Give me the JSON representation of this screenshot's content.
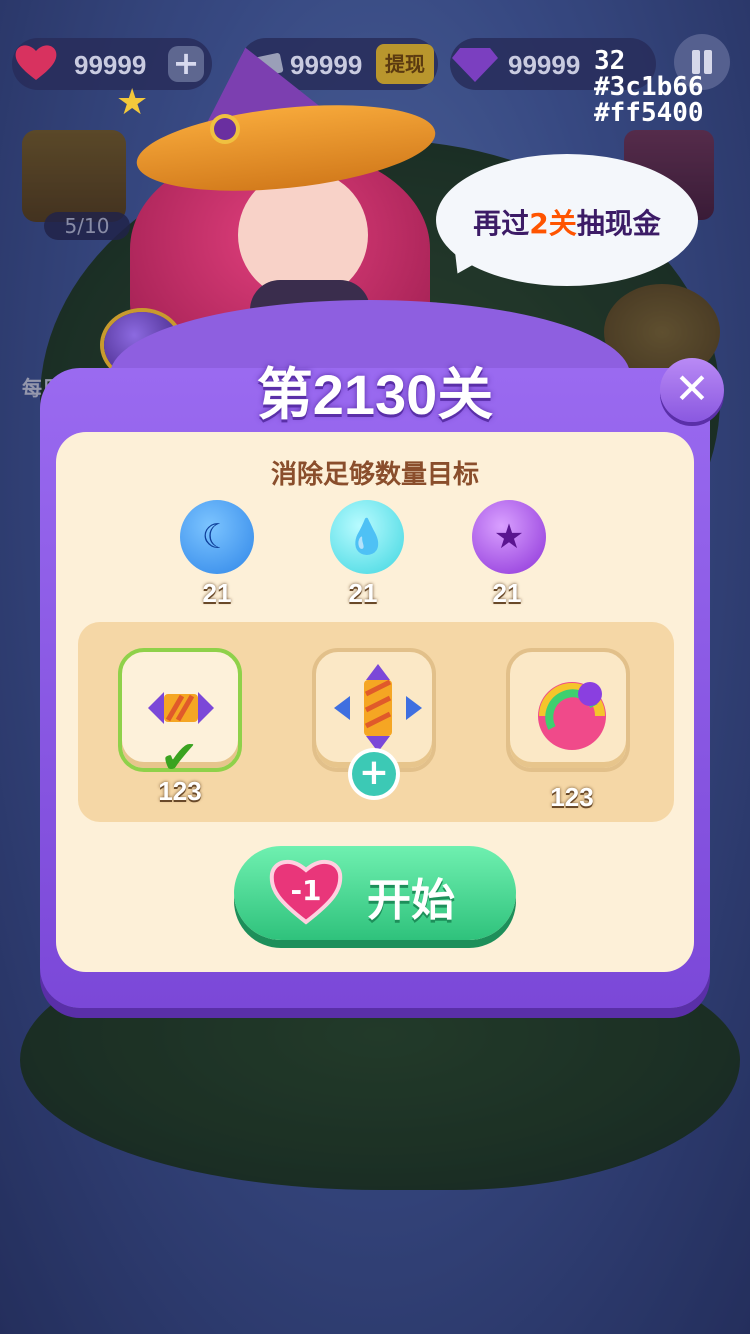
{
  "topbar": {
    "hearts": "99999",
    "coins": "99999",
    "cash_button": "提现",
    "gems": "99999"
  },
  "corner_debug": [
    "32",
    "#3c1b66",
    "#ff5400"
  ],
  "side": {
    "chest_progress": "5/10",
    "daily_label": "每日"
  },
  "bubble": {
    "prefix": "再过",
    "highlight": "2关",
    "suffix": "抽现金"
  },
  "modal": {
    "title": "第2130关",
    "goal_title": "消除足够数量目标",
    "targets": [
      {
        "icon": "blue-moon-candy-icon",
        "count": "21",
        "color": "#2f86e8"
      },
      {
        "icon": "cyan-drop-candy-icon",
        "count": "21",
        "color": "#3fd6e0"
      },
      {
        "icon": "purple-star-candy-icon",
        "count": "21",
        "color": "#8c32d8"
      }
    ],
    "boosters": [
      {
        "icon": "striped-candy-icon",
        "count": "123",
        "selected": true
      },
      {
        "icon": "cross-striped-candy-icon",
        "count": "",
        "selected": false
      },
      {
        "icon": "rainbow-ball-icon",
        "count": "123",
        "selected": false
      }
    ],
    "start": {
      "heart_cost": "-1",
      "label": "开始"
    }
  },
  "colors": {
    "bubble_text": "#3c1b66",
    "bubble_highlight": "#ff5400",
    "modal_purple": "#8a58e0",
    "start_green": "#2fc27c"
  }
}
